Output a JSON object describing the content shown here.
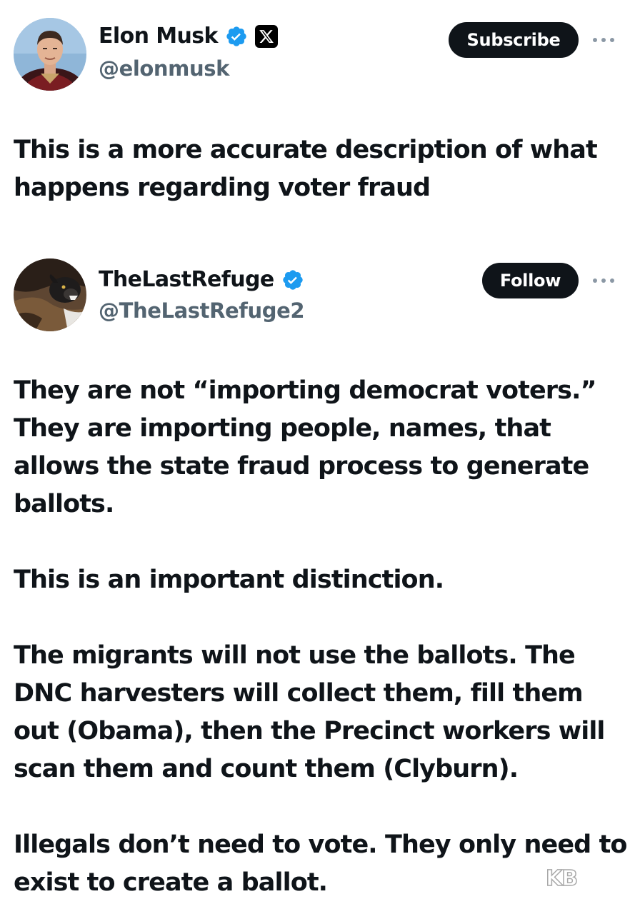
{
  "post": {
    "author_name": "Elon Musk",
    "author_handle": "@elonmusk",
    "subscribe_label": "Subscribe",
    "text_lines": [
      "This is a more accurate description of what",
      "happens regarding voter fraud"
    ]
  },
  "quoted_post": {
    "author_name": "TheLastRefuge",
    "author_handle": "@TheLastRefuge2",
    "follow_label": "Follow",
    "paragraphs": [
      [
        "They are not “importing democrat voters.”",
        "They are importing people, names, that",
        "allows the state fraud process to generate",
        "ballots."
      ],
      [
        "This is an important distinction."
      ],
      [
        "The migrants will not use the ballots. The",
        "DNC harvesters will collect them, fill them",
        "out (Obama), then the Precinct workers will",
        "scan them and count them (Clyburn)."
      ],
      [
        "Illegals don’t need to vote. They only need to",
        "exist to create a ballot."
      ]
    ]
  },
  "watermark": "KB",
  "colors": {
    "verified_blue": "#1d9bf0",
    "button_bg": "#0f1419",
    "text": "#0f1419",
    "handle_gray": "#536471"
  },
  "icons": {
    "verified": "verified-badge-icon",
    "affiliation": "x-logo-icon",
    "more": "more-options-icon"
  }
}
